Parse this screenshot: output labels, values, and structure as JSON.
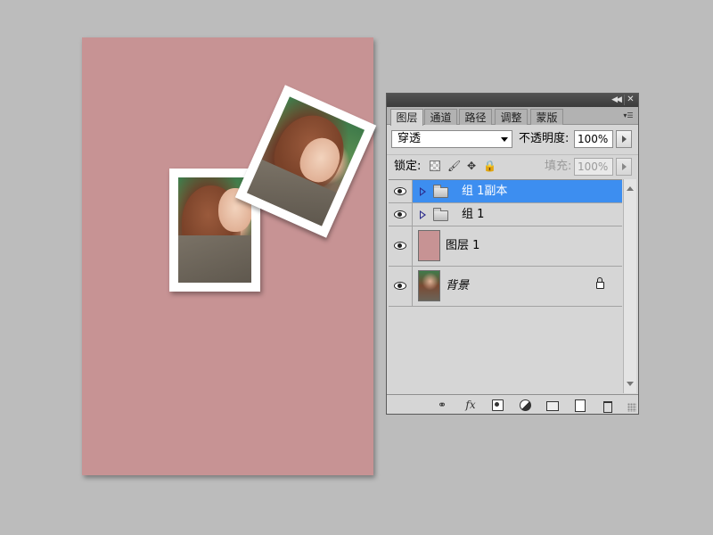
{
  "canvas": {
    "background_color": "#c79394"
  },
  "panel": {
    "tabs": [
      {
        "label": "图层",
        "active": true
      },
      {
        "label": "通道",
        "active": false
      },
      {
        "label": "路径",
        "active": false
      },
      {
        "label": "调整",
        "active": false
      },
      {
        "label": "蒙版",
        "active": false
      }
    ],
    "blend_mode": "穿透",
    "opacity_label": "不透明度:",
    "opacity_value": "100%",
    "lock_label": "锁定:",
    "fill_label": "填充:",
    "fill_value": "100%",
    "selected_color": "#3d8ef0",
    "layers": [
      {
        "name": "组 1副本",
        "type": "group",
        "visible": true,
        "selected": true
      },
      {
        "name": "组 1",
        "type": "group",
        "visible": true,
        "selected": false
      },
      {
        "name": "图层 1",
        "type": "layer",
        "visible": true,
        "selected": false
      },
      {
        "name": "背景",
        "type": "background",
        "visible": true,
        "selected": false,
        "locked": true
      }
    ],
    "icons": {
      "collapse": "double-chevron-left-icon",
      "close": "close-icon",
      "menu": "panel-menu-icon",
      "link": "link-icon",
      "fx": "fx-icon",
      "mask": "layer-mask-icon",
      "adjust": "adjustment-layer-icon",
      "new_group": "new-group-icon",
      "new_layer": "new-layer-icon",
      "delete": "trash-icon"
    }
  }
}
